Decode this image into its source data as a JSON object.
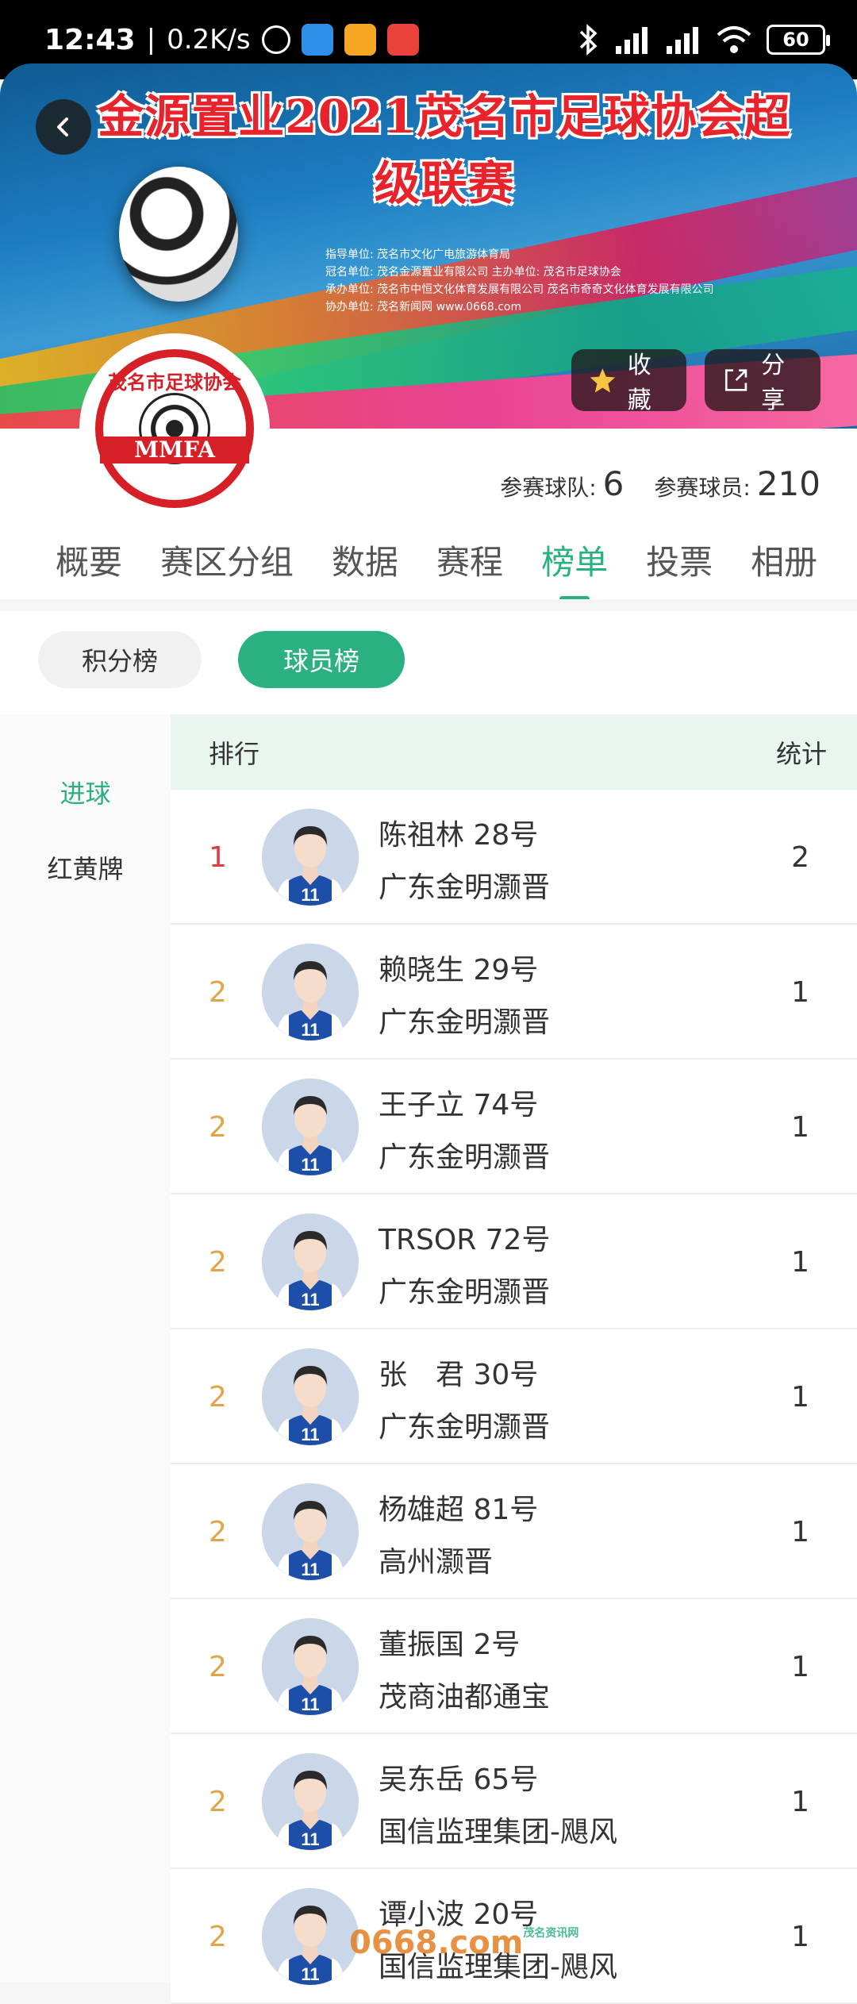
{
  "status_bar": {
    "time": "12:43",
    "speed": "0.2K/s",
    "battery": "60"
  },
  "banner": {
    "title": "金源置业2021茂名市足球协会超级联赛",
    "lines": [
      "指导单位: 茂名市文化广电旅游体育局",
      "冠名单位: 茂名金源置业有限公司   主办单位: 茂名市足球协会",
      "承办单位: 茂名市中恒文化体育发展有限公司   茂名市奇奇文化体育发展有限公司",
      "协办单位: 茂名新闻网 www.0668.com"
    ],
    "collect_label": "收藏",
    "share_label": "分享"
  },
  "logo": {
    "top_text": "茂名市足球协会",
    "band_text": "MMFA"
  },
  "counts": {
    "teams_label": "参赛球队:",
    "teams_value": "6",
    "players_label": "参赛球员:",
    "players_value": "210"
  },
  "tabs": [
    "概要",
    "赛区分组",
    "数据",
    "赛程",
    "榜单",
    "投票",
    "相册"
  ],
  "active_tab": "榜单",
  "pills": {
    "points": "积分榜",
    "players": "球员榜"
  },
  "side_nav": {
    "goals": "进球",
    "cards": "红黄牌"
  },
  "table": {
    "rank_header": "排行",
    "stat_header": "统计",
    "rows": [
      {
        "rank": "1",
        "name": "陈祖林 28号",
        "team": "广东金明灏晋",
        "stat": "2"
      },
      {
        "rank": "2",
        "name": "赖晓生 29号",
        "team": "广东金明灏晋",
        "stat": "1"
      },
      {
        "rank": "2",
        "name": "王子立 74号",
        "team": "广东金明灏晋",
        "stat": "1"
      },
      {
        "rank": "2",
        "name": "TRSOR 72号",
        "team": "广东金明灏晋",
        "stat": "1"
      },
      {
        "rank": "2",
        "name": "张　君 30号",
        "team": "广东金明灏晋",
        "stat": "1"
      },
      {
        "rank": "2",
        "name": "杨雄超 81号",
        "team": "高州灏晋",
        "stat": "1"
      },
      {
        "rank": "2",
        "name": "董振国 2号",
        "team": "茂商油都通宝",
        "stat": "1"
      },
      {
        "rank": "2",
        "name": "吴东岳 65号",
        "team": "国信监理集团-飓风",
        "stat": "1"
      },
      {
        "rank": "2",
        "name": "谭小波 20号",
        "team": "国信监理集团-飓风",
        "stat": "1"
      }
    ],
    "jersey_number": "11"
  },
  "watermark": {
    "text": "0668.com",
    "sub": "茂名资讯网"
  },
  "colors": {
    "accent": "#2bb07f",
    "rank_first": "#e23b3b",
    "rank_other": "#e0a44b"
  }
}
